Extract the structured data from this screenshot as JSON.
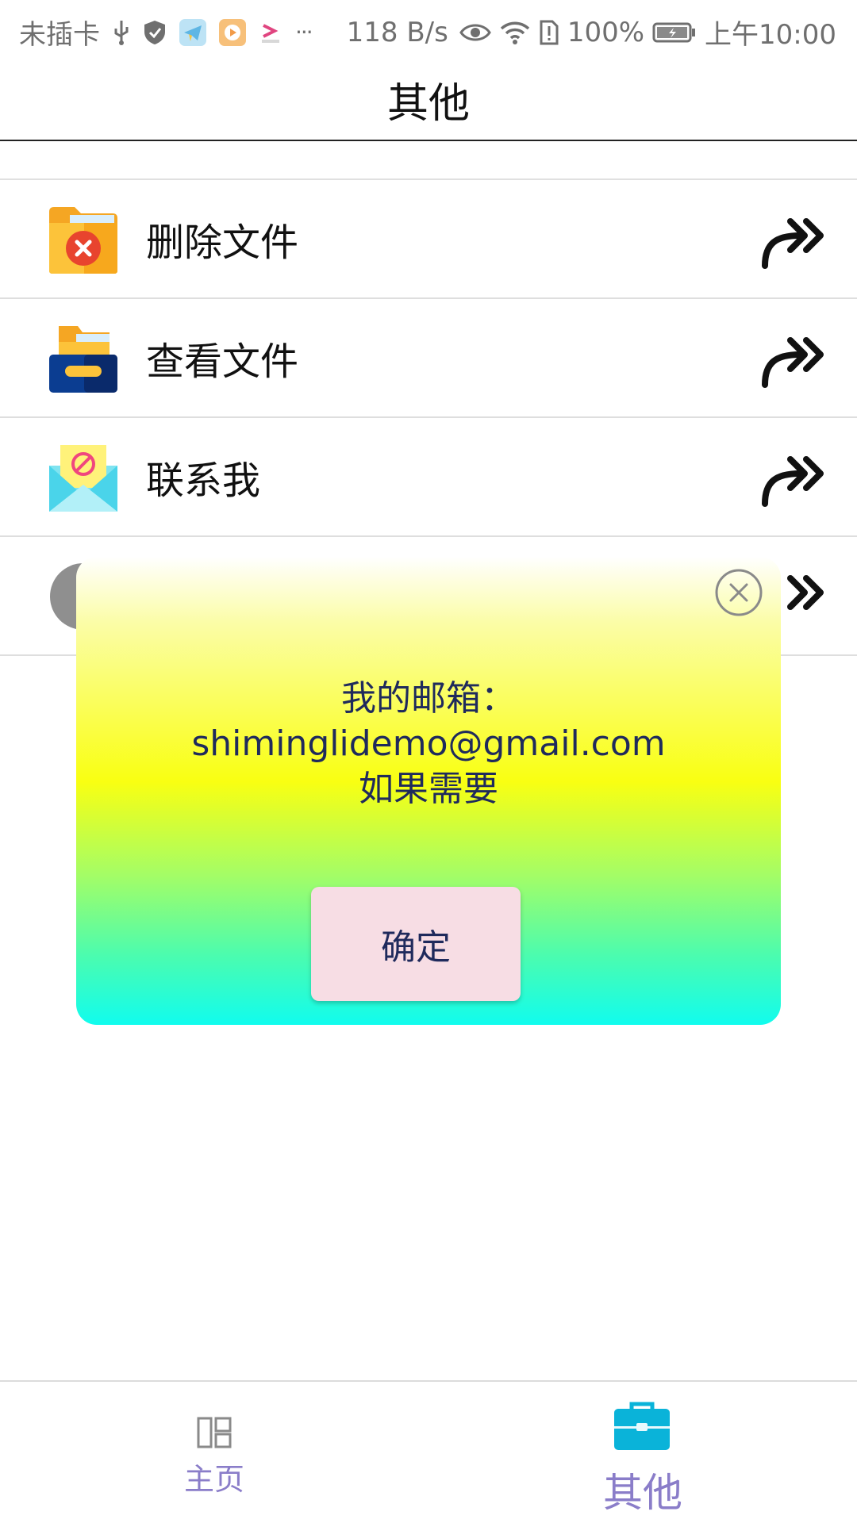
{
  "status_bar": {
    "carrier": "未插卡",
    "icons": [
      "usb-icon",
      "shield-icon",
      "telegram-icon",
      "video-app-icon",
      "app-icon",
      "more-icon"
    ],
    "more": "···",
    "net_speed": "118 B/s",
    "status_icons": [
      "eye-icon",
      "wifi-icon",
      "sim-alert-icon"
    ],
    "battery_percent": "100%",
    "time": "上午10:00"
  },
  "header": {
    "title": "其他"
  },
  "list": {
    "items": [
      {
        "label": "删除文件",
        "icon": "delete-folder-icon",
        "arrow": "forward-arrow-icon"
      },
      {
        "label": "查看文件",
        "icon": "view-folder-icon",
        "arrow": "forward-arrow-icon"
      },
      {
        "label": "联系我",
        "icon": "mail-icon",
        "arrow": "forward-arrow-icon"
      },
      {
        "label": "",
        "icon": "info-icon",
        "arrow": "forward-arrow-icon"
      }
    ]
  },
  "dialog": {
    "line1": "我的邮箱：",
    "line2": "shiminglidemo@gmail.com",
    "line3": "如果需要",
    "confirm_label": "确定",
    "close_icon": "close-icon"
  },
  "bottom_nav": {
    "items": [
      {
        "label": "主页",
        "icon": "dashboard-icon"
      },
      {
        "label": "其他",
        "icon": "briefcase-icon",
        "active": true
      }
    ]
  },
  "colors": {
    "accent": "#8a7dc9",
    "dialog_text": "#1f2a5c",
    "confirm_bg": "#f7dde4"
  }
}
